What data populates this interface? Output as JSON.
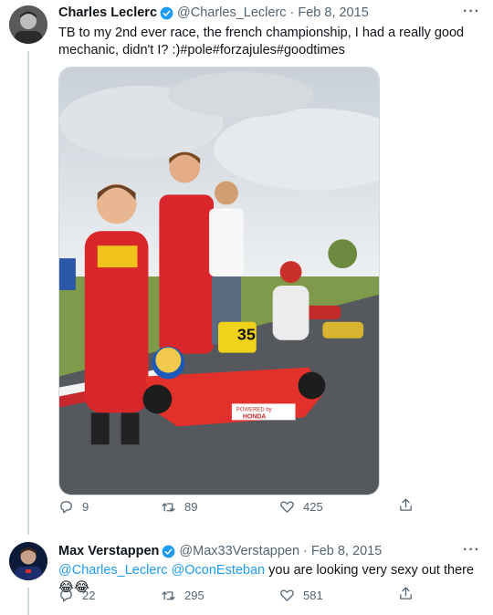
{
  "tweet1": {
    "name": "Charles Leclerc",
    "handle": "@Charles_Leclerc",
    "dot": "·",
    "date": "Feb 8, 2015",
    "more": "···",
    "text": "TB to my 2nd ever race, the french championship, I had a really good mechanic, didn't I? :)#pole#forzajules#goodtimes",
    "photo": {
      "kart_number": "35",
      "sponsor_line1": "POWERED by",
      "sponsor_line2": "HONDA"
    },
    "actions": {
      "replies": "9",
      "retweets": "89",
      "likes": "425"
    }
  },
  "tweet2": {
    "name": "Max Verstappen",
    "handle": "@Max33Verstappen",
    "dot": "·",
    "date": "Feb 8, 2015",
    "more": "···",
    "mention1": "@Charles_Leclerc",
    "mention2": "@OconEsteban",
    "text_rest": "you are looking very sexy out there 😂😂",
    "actions": {
      "replies": "22",
      "retweets": "295",
      "likes": "581"
    }
  },
  "colors": {
    "accent": "#1d9bf0",
    "muted": "#536471",
    "text": "#0f1419",
    "line": "#cfd9de"
  },
  "icons": [
    "verified-badge-icon",
    "more-icon",
    "reply-icon",
    "retweet-icon",
    "like-icon",
    "share-icon"
  ]
}
